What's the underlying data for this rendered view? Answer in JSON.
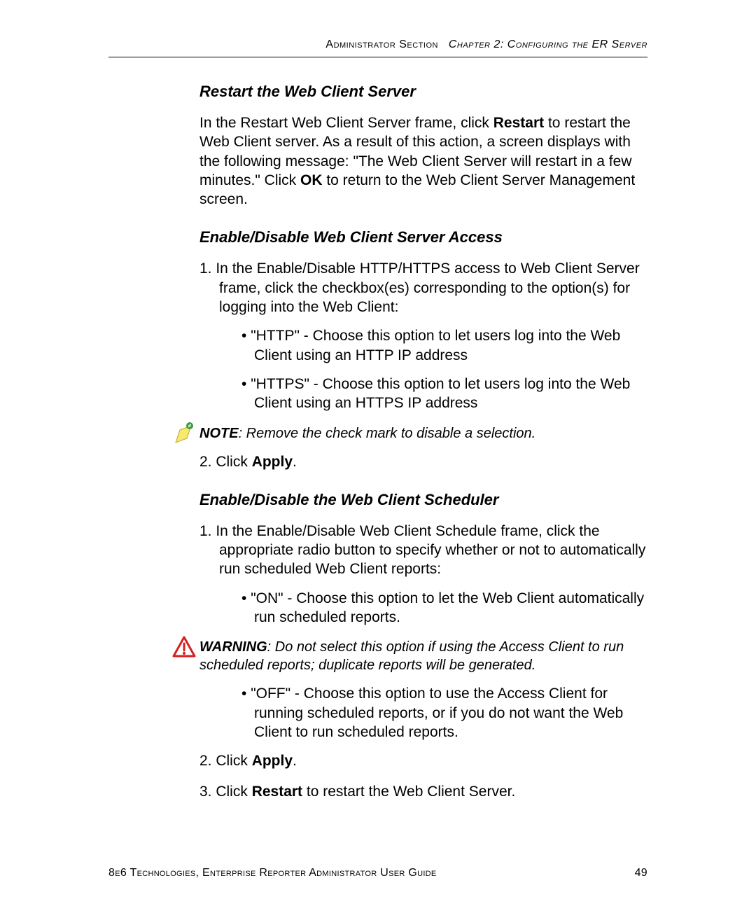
{
  "header": {
    "left": "Administrator Section",
    "right_italic": "Chapter 2: Configuring the ER Server"
  },
  "sections": {
    "s1": {
      "heading": "Restart the Web Client Server",
      "para_pre": "In the Restart Web Client Server frame, click ",
      "para_bold1": "Restart",
      "para_mid": " to restart the Web Client server. As a result of this action, a screen displays with the following message: \"The Web Client Server will restart in a few minutes.\" Click ",
      "para_bold2": "OK",
      "para_post": " to return to the Web Client Server Management screen."
    },
    "s2": {
      "heading": "Enable/Disable Web Client Server Access",
      "item1": "1. In the Enable/Disable HTTP/HTTPS access to Web Client Server frame, click the checkbox(es) corresponding to the option(s) for logging into the Web Client:",
      "bullet1": "\"HTTP\" - Choose this option to let users log into the Web Client using an HTTP IP address",
      "bullet2": "\"HTTPS\" - Choose this option to let users log into the Web Client using an HTTPS IP address",
      "note_label": "NOTE",
      "note_text": ": Remove the check mark to disable a selection.",
      "item2_pre": "2. Click ",
      "item2_bold": "Apply",
      "item2_post": "."
    },
    "s3": {
      "heading": "Enable/Disable the Web Client Scheduler",
      "item1": "1. In the Enable/Disable Web Client Schedule frame, click the appropriate radio button to specify whether or not to automatically run scheduled Web Client reports:",
      "bullet1": "\"ON\" - Choose this option to let the Web Client automatically run scheduled reports.",
      "warn_label": "WARNING",
      "warn_text": ": Do not select this option if using the Access Client to run scheduled reports; duplicate reports will be generated.",
      "bullet2": "\"OFF\" - Choose this option to use the Access Client for running scheduled reports, or if you do not want the Web Client to run scheduled reports.",
      "item2_pre": "2. Click ",
      "item2_bold": "Apply",
      "item2_post": ".",
      "item3_pre": "3. Click ",
      "item3_bold": "Restart",
      "item3_post": " to restart the Web Client Server."
    }
  },
  "footer": {
    "text": "8e6 Technologies, Enterprise Reporter Administrator User Guide",
    "page": "49"
  }
}
